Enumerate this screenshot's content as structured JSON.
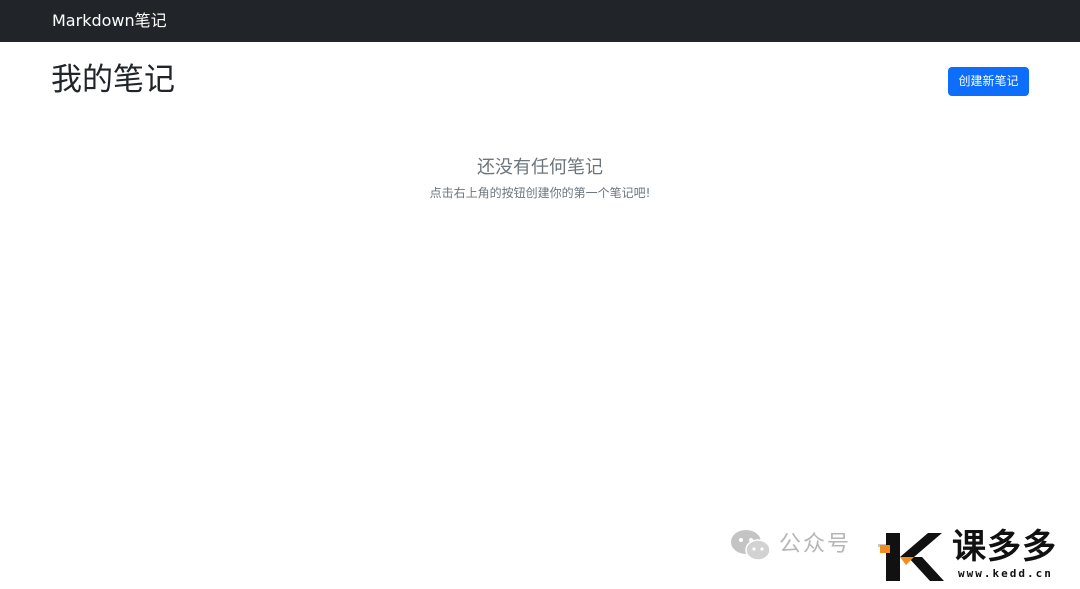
{
  "navbar": {
    "brand": "Markdown笔记"
  },
  "header": {
    "title": "我的笔记",
    "create_button_label": "创建新笔记"
  },
  "empty_state": {
    "title": "还没有任何笔记",
    "subtitle": "点击右上角的按钮创建你的第一个笔记吧!"
  },
  "watermark": {
    "account": "公众号",
    "logo_text": "课多多",
    "url": "www.kedd.cn",
    "wechat_icon": "wechat-icon"
  },
  "colors": {
    "navbar_bg": "#212529",
    "primary": "#0d6efd",
    "muted_text": "#6c757d"
  }
}
